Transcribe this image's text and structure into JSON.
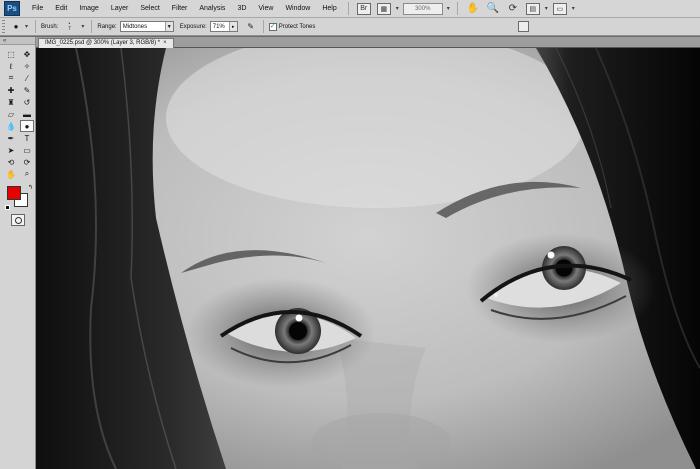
{
  "app": {
    "logo_text": "Ps"
  },
  "menu": {
    "items": [
      "File",
      "Edit",
      "Image",
      "Layer",
      "Select",
      "Filter",
      "Analysis",
      "3D",
      "View",
      "Window",
      "Help"
    ],
    "zoom_value": "300%"
  },
  "options_bar": {
    "brush_label": "Brush:",
    "brush_size": "7",
    "range_label": "Range:",
    "range_value": "Midtones",
    "exposure_label": "Exposure:",
    "exposure_value": "71%",
    "protect_tones_label": "Protect Tones",
    "protect_tones_checked": true
  },
  "tools": {
    "foreground_color": "#e60000",
    "background_color": "#ffffff",
    "items": [
      "marquee-icon",
      "move-icon",
      "lasso-icon",
      "magic-wand-icon",
      "crop-icon",
      "eyedropper-icon",
      "healing-brush-icon",
      "brush-icon",
      "clone-stamp-icon",
      "history-brush-icon",
      "eraser-icon",
      "gradient-icon",
      "blur-icon",
      "dodge-icon",
      "pen-icon",
      "type-icon",
      "path-select-icon",
      "shape-icon",
      "3d-rotate-icon",
      "3d-orbit-icon",
      "hand-icon",
      "zoom-icon"
    ],
    "active_tool": "dodge-icon"
  },
  "document": {
    "tab_title": "IMG_0225.psd @ 300% (Layer 3, RGB/8) *"
  },
  "colors": {
    "menubar_bg": "#d6d6d6",
    "panel_bg": "#d4d4d4",
    "workspace_bg": "#6b6b6b"
  }
}
